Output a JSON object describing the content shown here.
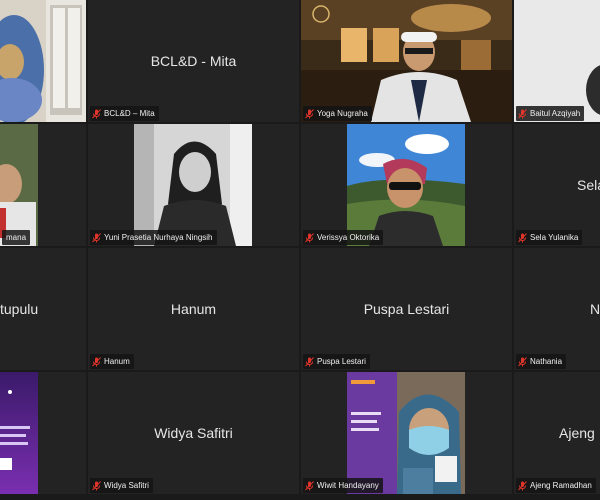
{
  "meeting": {
    "tiles": [
      {
        "name": "",
        "label": ""
      },
      {
        "name": "BCL&D - Mita",
        "label": "BCL&D – Mita"
      },
      {
        "name": "",
        "label": "Yoga Nugraha"
      },
      {
        "name": "",
        "label": "Baitul Azqiyah"
      },
      {
        "name": "",
        "label": "mana"
      },
      {
        "name": "",
        "label": "Yuni Prasetia Nurhaya Ningsih"
      },
      {
        "name": "",
        "label": "Verissya Oktorika"
      },
      {
        "name": "Sela",
        "label": "Sela Yulanika"
      },
      {
        "name": "tupulu",
        "label": ""
      },
      {
        "name": "Hanum",
        "label": "Hanum"
      },
      {
        "name": "Puspa Lestari",
        "label": "Puspa Lestari"
      },
      {
        "name": "N",
        "label": "Nathania"
      },
      {
        "name": "",
        "label": ""
      },
      {
        "name": "Widya Safitri",
        "label": "Widya Safitri"
      },
      {
        "name": "",
        "label": "Wiwit Handayany"
      },
      {
        "name": "Ajeng",
        "label": "Ajeng Ramadhan"
      }
    ],
    "colors": {
      "active_border": "#b5e61d",
      "muted_mic": "#e0352b",
      "tile_bg": "#232323",
      "grid_bg": "#1a1a1a"
    },
    "icons": {
      "mic": "mic-muted-icon"
    }
  }
}
